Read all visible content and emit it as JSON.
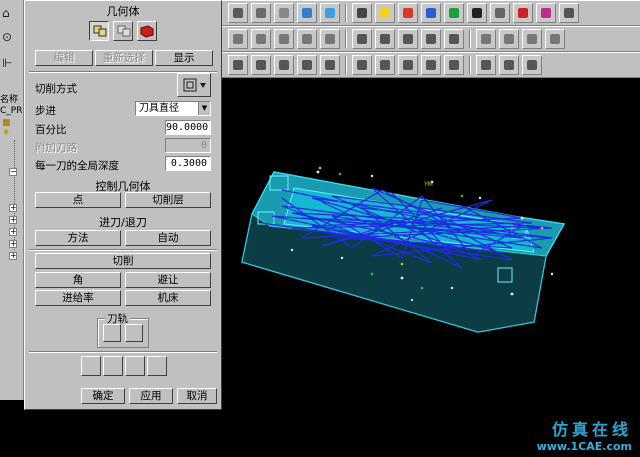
{
  "dialog": {
    "title": "几何体",
    "buttons_top": {
      "edit": "编辑",
      "reselect": "重新选择",
      "display": "显示"
    },
    "cut_method": {
      "label": "切削方式"
    },
    "step": {
      "label": "步进",
      "value": "刀具直径"
    },
    "percent": {
      "label": "百分比",
      "value": "90.0000"
    },
    "extra_passes": {
      "label": "附加刀路",
      "value": "0"
    },
    "global_depth": {
      "label": "每一刀的全局深度",
      "value": "0.3000"
    },
    "control_geometry": {
      "label": "控制几何体",
      "point": "点",
      "cut_levels": "切削层"
    },
    "engage_retract": {
      "label": "进刀/退刀",
      "method": "方法",
      "auto": "自动"
    },
    "cutting": {
      "label": "切削",
      "corner": "角",
      "avoidance": "避让",
      "feeds": "进给率",
      "machine": "机床"
    },
    "tool_path": {
      "label": "刀轨"
    },
    "footer": {
      "ok": "确定",
      "apply": "应用",
      "cancel": "取消"
    }
  },
  "navigator": {
    "label_1": "名称",
    "label_2": "C_PR"
  },
  "viewport": {
    "axis_label": "YM"
  },
  "watermark": {
    "text_cn": "仿真在线",
    "url": "www.1CAE.com"
  },
  "colors": {
    "part_cyan": "#1fc8e0",
    "toolpath_blue": "#1836d8",
    "accent_green": "#19c24a"
  },
  "toolbar_icons": [
    "undo-icon",
    "mesh-icon",
    "shaded-icon",
    "cube-icon",
    "pin-icon",
    "lightbulb-icon",
    "color-icon",
    "3d-view-icon",
    "green-square-icon",
    "info-icon",
    "mirror-icon",
    "chinese-input-icon",
    "3d-logo-icon",
    "list-icon"
  ]
}
